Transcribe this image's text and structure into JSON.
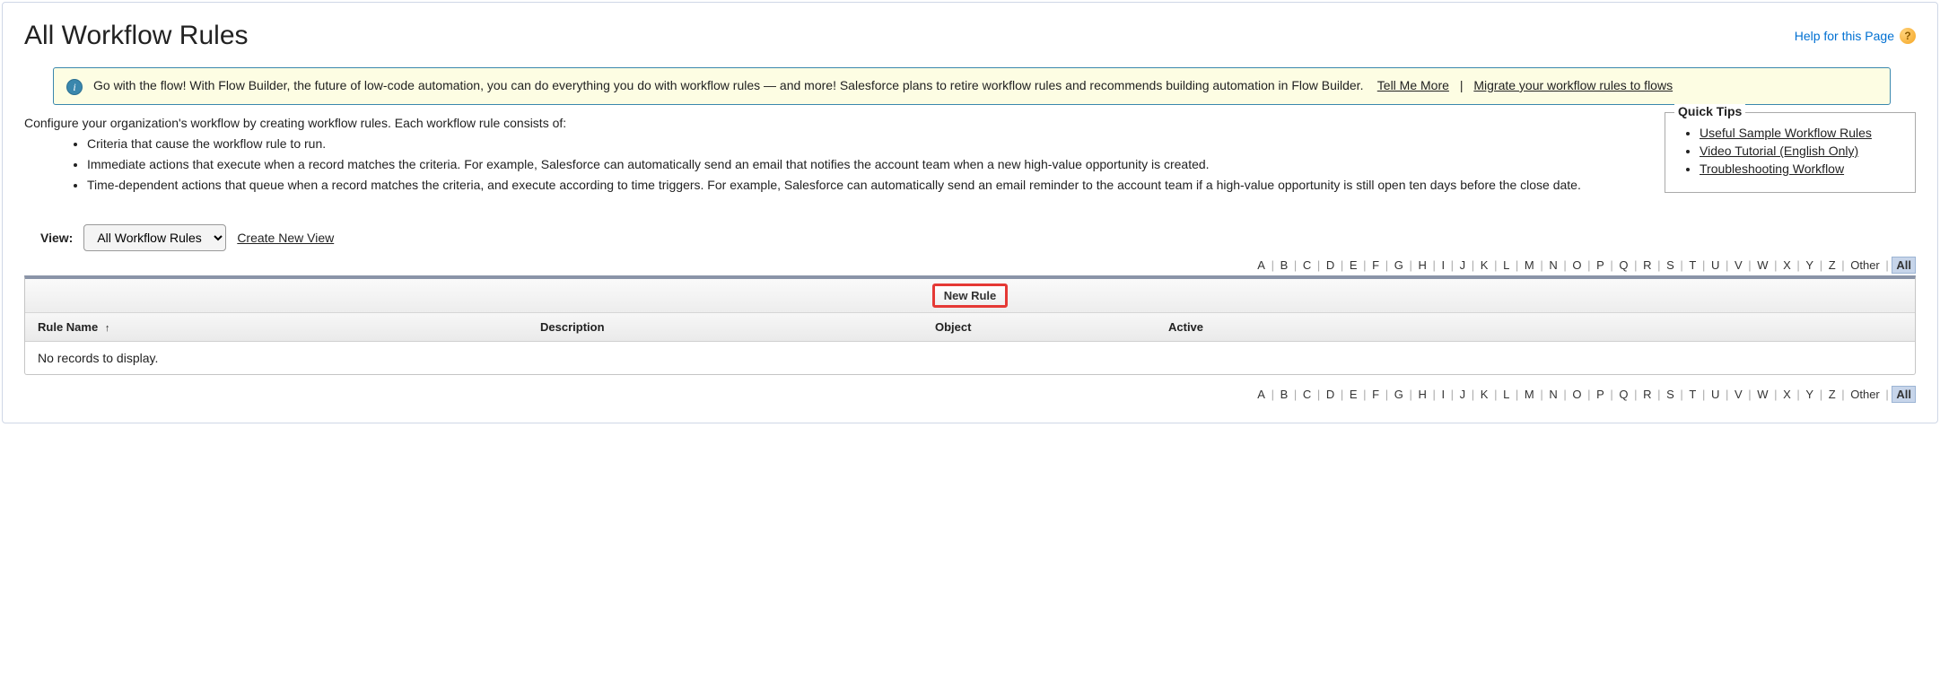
{
  "header": {
    "title": "All Workflow Rules",
    "help_label": "Help for this Page"
  },
  "banner": {
    "text_before": "Go with the flow! With Flow Builder, the future of low-code automation, you can do everything you do with workflow rules — and more! Salesforce plans to retire workflow rules and recommends building automation in Flow Builder.",
    "link_tell": "Tell Me More",
    "link_migrate": "Migrate your workflow rules to flows"
  },
  "intro": {
    "lead": "Configure your organization's workflow by creating workflow rules. Each workflow rule consists of:",
    "bullets": [
      "Criteria that cause the workflow rule to run.",
      "Immediate actions that execute when a record matches the criteria. For example, Salesforce can automatically send an email that notifies the account team when a new high-value opportunity is created.",
      "Time-dependent actions that queue when a record matches the criteria, and execute according to time triggers. For example, Salesforce can automatically send an email reminder to the account team if a high-value opportunity is still open ten days before the close date."
    ]
  },
  "quick_tips": {
    "title": "Quick Tips",
    "links": [
      "Useful Sample Workflow Rules",
      "Video Tutorial (English Only)",
      "Troubleshooting Workflow"
    ]
  },
  "view": {
    "label": "View:",
    "selected": "All Workflow Rules",
    "create_label": "Create New View"
  },
  "alpha": {
    "letters": [
      "A",
      "B",
      "C",
      "D",
      "E",
      "F",
      "G",
      "H",
      "I",
      "J",
      "K",
      "L",
      "M",
      "N",
      "O",
      "P",
      "Q",
      "R",
      "S",
      "T",
      "U",
      "V",
      "W",
      "X",
      "Y",
      "Z"
    ],
    "other": "Other",
    "all": "All"
  },
  "table": {
    "new_rule_label": "New Rule",
    "columns": {
      "rule_name": "Rule Name",
      "description": "Description",
      "object": "Object",
      "active": "Active"
    },
    "empty": "No records to display."
  }
}
